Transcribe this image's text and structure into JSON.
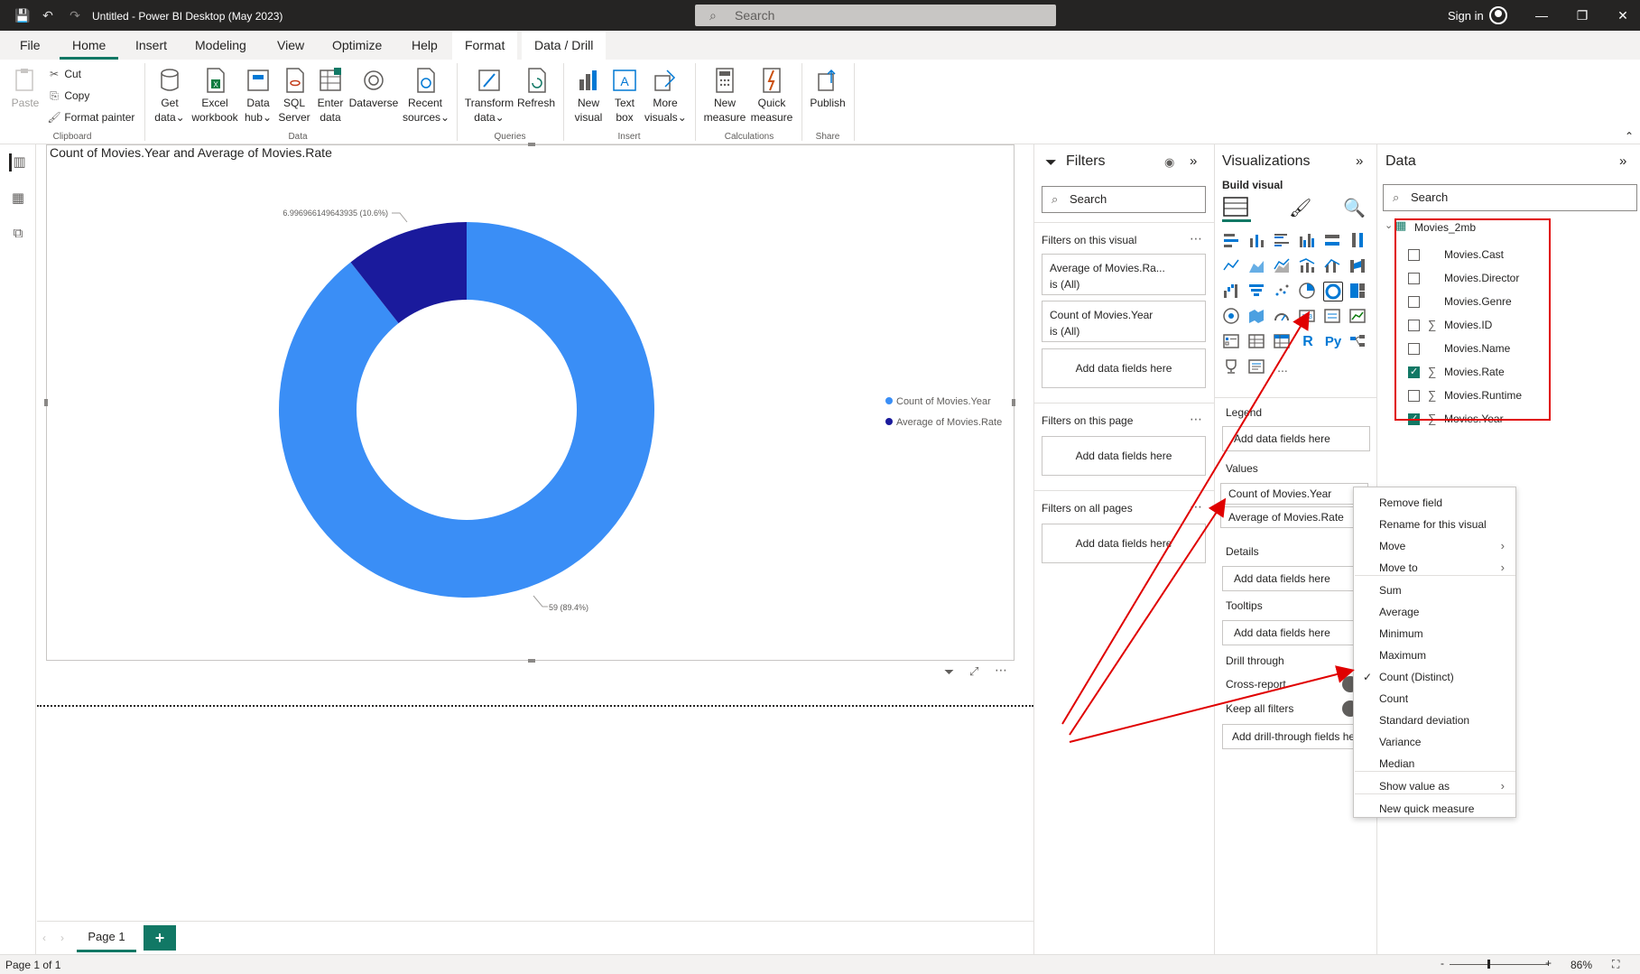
{
  "titlebar": {
    "title": "Untitled - Power BI Desktop (May 2023)",
    "search_placeholder": "Search",
    "signin": "Sign in"
  },
  "tabs": [
    "File",
    "Home",
    "Insert",
    "Modeling",
    "View",
    "Optimize",
    "Help",
    "Format",
    "Data / Drill"
  ],
  "active_tab": "Home",
  "ribbon": {
    "clipboard": {
      "paste": "Paste",
      "cut": "Cut",
      "copy": "Copy",
      "format_painter": "Format painter",
      "group": "Clipboard"
    },
    "data": {
      "get_data": [
        "Get",
        "data"
      ],
      "excel": [
        "Excel",
        "workbook"
      ],
      "data_hub": [
        "Data",
        "hub"
      ],
      "sql": [
        "SQL",
        "Server"
      ],
      "enter": [
        "Enter",
        "data"
      ],
      "dataverse": "Dataverse",
      "recent": [
        "Recent",
        "sources"
      ],
      "group": "Data"
    },
    "queries": {
      "transform": [
        "Transform",
        "data"
      ],
      "refresh": "Refresh",
      "group": "Queries"
    },
    "insert": {
      "new_visual": [
        "New",
        "visual"
      ],
      "text_box": [
        "Text",
        "box"
      ],
      "more_visuals": [
        "More",
        "visuals"
      ],
      "group": "Insert"
    },
    "calculations": {
      "new_measure": [
        "New",
        "measure"
      ],
      "quick_measure": [
        "Quick",
        "measure"
      ],
      "group": "Calculations"
    },
    "share": {
      "publish": "Publish",
      "group": "Share"
    }
  },
  "visual": {
    "title": "Count of Movies.Year and Average of Movies.Rate",
    "label_small": "6.996966149643935 (10.6%)",
    "label_large": "59 (89.4%)",
    "legend": [
      "Count of Movies.Year",
      "Average of Movies.Rate"
    ]
  },
  "chart_data": {
    "type": "pie",
    "variant": "donut",
    "title": "Count of Movies.Year and Average of Movies.Rate",
    "categories": [
      "Count of Movies.Year",
      "Average of Movies.Rate"
    ],
    "values": [
      59,
      6.996966149643935
    ],
    "percent_labels": [
      "59 (89.4%)",
      "6.996966149643935 (10.6%)"
    ],
    "colors": [
      "#3a8ef6",
      "#1a1a9c"
    ],
    "legend": "right"
  },
  "page_tabs": {
    "page1": "Page 1",
    "add": "+"
  },
  "filters": {
    "title": "Filters",
    "search": "Search",
    "on_visual": "Filters on this visual",
    "cards": [
      {
        "field": "Average of Movies.Ra...",
        "state": "is (All)"
      },
      {
        "field": "Count of Movies.Year",
        "state": "is (All)"
      }
    ],
    "add": "Add data fields here",
    "on_page": "Filters on this page",
    "on_all": "Filters on all pages"
  },
  "visualizations": {
    "title": "Visualizations",
    "build": "Build visual",
    "legend_label": "Legend",
    "add": "Add data fields here",
    "values_label": "Values",
    "value_fields": [
      "Count of Movies.Year",
      "Average of Movies.Rate"
    ],
    "details_label": "Details",
    "tooltips_label": "Tooltips",
    "drill_label": "Drill through",
    "cross_report": "Cross-report",
    "keep_filters": "Keep all filters",
    "add_drill": "Add drill-through fields he",
    "r_label": "R",
    "py_label": "Py",
    "more": "..."
  },
  "data_pane": {
    "title": "Data",
    "search": "Search",
    "table": "Movies_2mb",
    "fields": [
      {
        "name": "Movies.Cast",
        "sigma": false,
        "checked": false
      },
      {
        "name": "Movies.Director",
        "sigma": false,
        "checked": false
      },
      {
        "name": "Movies.Genre",
        "sigma": false,
        "checked": false
      },
      {
        "name": "Movies.ID",
        "sigma": true,
        "checked": false
      },
      {
        "name": "Movies.Name",
        "sigma": false,
        "checked": false
      },
      {
        "name": "Movies.Rate",
        "sigma": true,
        "checked": true
      },
      {
        "name": "Movies.Runtime",
        "sigma": true,
        "checked": false
      },
      {
        "name": "Movies.Year",
        "sigma": true,
        "checked": true
      }
    ],
    "highlight_color": "#e00000"
  },
  "context_menu": {
    "items": [
      "Remove field",
      "Rename for this visual",
      "Move",
      "Move to",
      "Sum",
      "Average",
      "Minimum",
      "Maximum",
      "Count (Distinct)",
      "Count",
      "Standard deviation",
      "Variance",
      "Median",
      "Show value as",
      "New quick measure"
    ],
    "checked": "Count (Distinct)",
    "check_glyph": "✓"
  },
  "statusbar": {
    "page": "Page 1 of 1",
    "zoom": "86%",
    "minus": "-",
    "plus": "+"
  },
  "annotation_color": "#e00000"
}
